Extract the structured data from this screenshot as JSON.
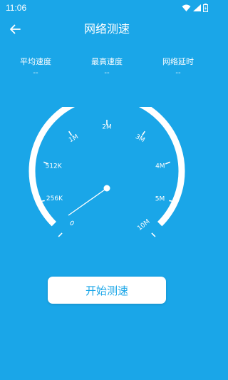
{
  "status_bar": {
    "time": "11:06"
  },
  "header": {
    "title": "网络测速"
  },
  "stats": [
    {
      "label": "平均速度",
      "value": "--"
    },
    {
      "label": "最高速度",
      "value": "--"
    },
    {
      "label": "网络延时",
      "value": "--"
    }
  ],
  "gauge": {
    "scale_labels": [
      "0",
      "256K",
      "512K",
      "1M",
      "2M",
      "3M",
      "4M",
      "5M",
      "10M"
    ],
    "needle_value": "0"
  },
  "start_button": {
    "label": "开始测速"
  },
  "colors": {
    "background": "#1aa6e8",
    "foreground": "#ffffff",
    "accent": "#1aa6e8"
  }
}
